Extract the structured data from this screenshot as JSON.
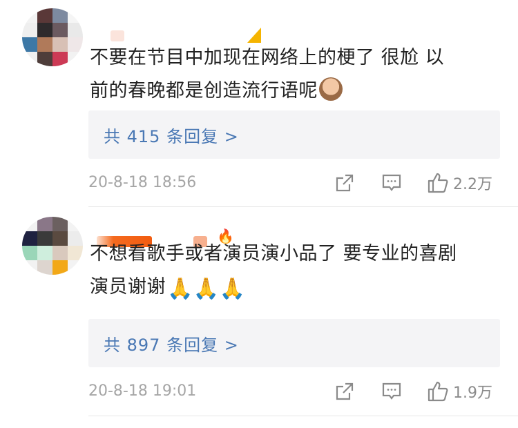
{
  "comments": [
    {
      "text_line1": "不要在节目中加现在网络上的梗了 很尬 以",
      "text_line2": "前的春晚都是创造流行语呢",
      "emoji": "see-no-evil-monkey",
      "replies_label": "共 415 条回复 >",
      "timestamp": "20-8-18 18:56",
      "like_count": "2.2万"
    },
    {
      "text_line1": "不想看歌手或者演员演小品了 要专业的喜剧",
      "text_line2": "演员谢谢",
      "emoji": "folded-hands",
      "replies_label": "共 897 条回复 >",
      "timestamp": "20-8-18 19:01",
      "like_count": "1.9万"
    }
  ],
  "icons": {
    "share": "share-icon",
    "comment": "comment-icon",
    "like": "thumbs-up-icon"
  },
  "colors": {
    "link": "#4a78b4",
    "timestamp": "#a6a6a6",
    "reply_box_bg": "#f4f4f6",
    "badge_orange": "#f46a1f"
  }
}
